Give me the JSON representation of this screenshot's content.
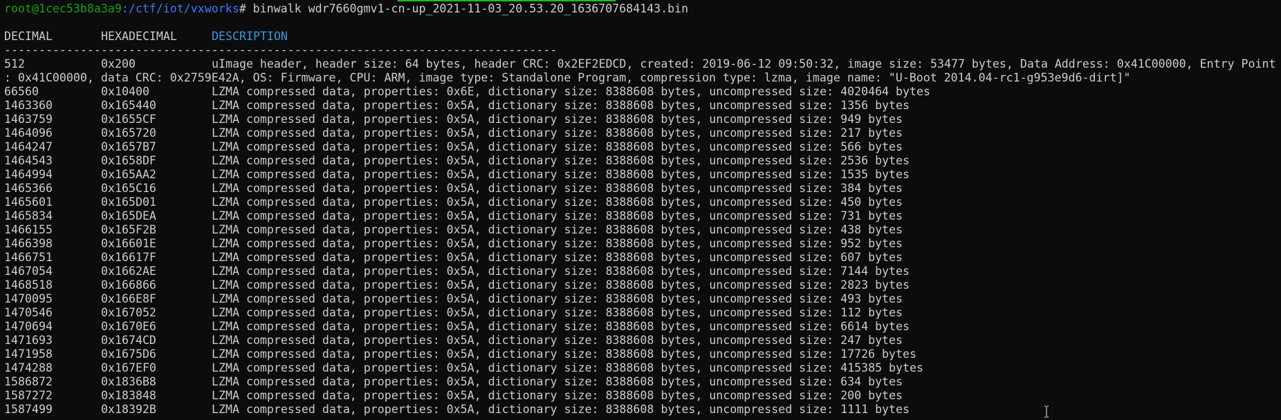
{
  "terminal": {
    "prompt_user_host": "root@1cec53b8a3a9",
    "prompt_path": ":/ctf/iot/vxworks",
    "prompt_symbol": "# ",
    "command": "binwalk wdr7660gmv1-cn-up_2021-11-03_20.53.20_1636707684143.bin",
    "header": {
      "decimal": "DECIMAL",
      "hex": "HEXADECIMAL",
      "description": "DESCRIPTION"
    },
    "separator": "--------------------------------------------------------------------------------",
    "first_row": {
      "dec": "512",
      "hex": "0x200",
      "desc_line1": "uImage header, header size: 64 bytes, header CRC: 0x2EF2EDCD, created: 2019-06-12 09:50:32, image size: 53477 bytes, Data Address: 0x41C00000, Entry Point",
      "desc_line2": ": 0x41C00000, data CRC: 0x2759E42A, OS: Firmware, CPU: ARM, image type: Standalone Program, compression type: lzma, image name: \"U-Boot 2014.04-rc1-g953e9d6-dirt]\""
    },
    "rows": [
      {
        "dec": "66560",
        "hex": "0x10400",
        "desc": "LZMA compressed data, properties: 0x6E, dictionary size: 8388608 bytes, uncompressed size: 4020464 bytes"
      },
      {
        "dec": "1463360",
        "hex": "0x165440",
        "desc": "LZMA compressed data, properties: 0x5A, dictionary size: 8388608 bytes, uncompressed size: 1356 bytes"
      },
      {
        "dec": "1463759",
        "hex": "0x1655CF",
        "desc": "LZMA compressed data, properties: 0x5A, dictionary size: 8388608 bytes, uncompressed size: 949 bytes"
      },
      {
        "dec": "1464096",
        "hex": "0x165720",
        "desc": "LZMA compressed data, properties: 0x5A, dictionary size: 8388608 bytes, uncompressed size: 217 bytes"
      },
      {
        "dec": "1464247",
        "hex": "0x1657B7",
        "desc": "LZMA compressed data, properties: 0x5A, dictionary size: 8388608 bytes, uncompressed size: 566 bytes"
      },
      {
        "dec": "1464543",
        "hex": "0x1658DF",
        "desc": "LZMA compressed data, properties: 0x5A, dictionary size: 8388608 bytes, uncompressed size: 2536 bytes"
      },
      {
        "dec": "1464994",
        "hex": "0x165AA2",
        "desc": "LZMA compressed data, properties: 0x5A, dictionary size: 8388608 bytes, uncompressed size: 1535 bytes"
      },
      {
        "dec": "1465366",
        "hex": "0x165C16",
        "desc": "LZMA compressed data, properties: 0x5A, dictionary size: 8388608 bytes, uncompressed size: 384 bytes"
      },
      {
        "dec": "1465601",
        "hex": "0x165D01",
        "desc": "LZMA compressed data, properties: 0x5A, dictionary size: 8388608 bytes, uncompressed size: 450 bytes"
      },
      {
        "dec": "1465834",
        "hex": "0x165DEA",
        "desc": "LZMA compressed data, properties: 0x5A, dictionary size: 8388608 bytes, uncompressed size: 731 bytes"
      },
      {
        "dec": "1466155",
        "hex": "0x165F2B",
        "desc": "LZMA compressed data, properties: 0x5A, dictionary size: 8388608 bytes, uncompressed size: 438 bytes"
      },
      {
        "dec": "1466398",
        "hex": "0x16601E",
        "desc": "LZMA compressed data, properties: 0x5A, dictionary size: 8388608 bytes, uncompressed size: 952 bytes"
      },
      {
        "dec": "1466751",
        "hex": "0x16617F",
        "desc": "LZMA compressed data, properties: 0x5A, dictionary size: 8388608 bytes, uncompressed size: 607 bytes"
      },
      {
        "dec": "1467054",
        "hex": "0x1662AE",
        "desc": "LZMA compressed data, properties: 0x5A, dictionary size: 8388608 bytes, uncompressed size: 7144 bytes"
      },
      {
        "dec": "1468518",
        "hex": "0x166866",
        "desc": "LZMA compressed data, properties: 0x5A, dictionary size: 8388608 bytes, uncompressed size: 2823 bytes"
      },
      {
        "dec": "1470095",
        "hex": "0x166E8F",
        "desc": "LZMA compressed data, properties: 0x5A, dictionary size: 8388608 bytes, uncompressed size: 493 bytes"
      },
      {
        "dec": "1470546",
        "hex": "0x167052",
        "desc": "LZMA compressed data, properties: 0x5A, dictionary size: 8388608 bytes, uncompressed size: 112 bytes"
      },
      {
        "dec": "1470694",
        "hex": "0x1670E6",
        "desc": "LZMA compressed data, properties: 0x5A, dictionary size: 8388608 bytes, uncompressed size: 6614 bytes"
      },
      {
        "dec": "1471693",
        "hex": "0x1674CD",
        "desc": "LZMA compressed data, properties: 0x5A, dictionary size: 8388608 bytes, uncompressed size: 247 bytes"
      },
      {
        "dec": "1471958",
        "hex": "0x1675D6",
        "desc": "LZMA compressed data, properties: 0x5A, dictionary size: 8388608 bytes, uncompressed size: 17726 bytes"
      },
      {
        "dec": "1474288",
        "hex": "0x167EF0",
        "desc": "LZMA compressed data, properties: 0x5A, dictionary size: 8388608 bytes, uncompressed size: 415385 bytes"
      },
      {
        "dec": "1586872",
        "hex": "0x1836B8",
        "desc": "LZMA compressed data, properties: 0x5A, dictionary size: 8388608 bytes, uncompressed size: 634 bytes"
      },
      {
        "dec": "1587272",
        "hex": "0x183848",
        "desc": "LZMA compressed data, properties: 0x5A, dictionary size: 8388608 bytes, uncompressed size: 200 bytes"
      },
      {
        "dec": "1587499",
        "hex": "0x18392B",
        "desc": "LZMA compressed data, properties: 0x5A, dictionary size: 8388608 bytes, uncompressed size: 1111 bytes"
      }
    ]
  },
  "colors": {
    "background": "#0c0c0c",
    "text": "#cccccc",
    "prompt_user": "#13a10e",
    "prompt_path": "#3b78ff",
    "description_header": "#3a96dd"
  },
  "icons": {
    "cursor": "ibeam-cursor-icon"
  }
}
